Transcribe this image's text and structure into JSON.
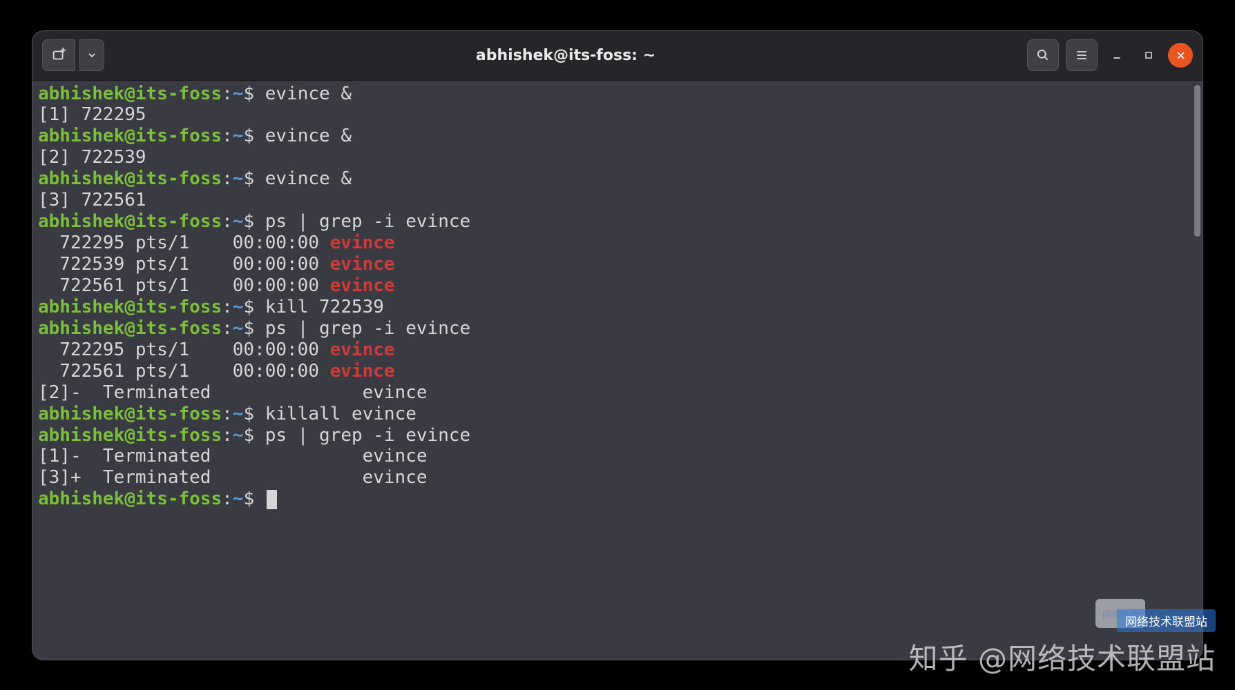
{
  "titlebar": {
    "title": "abhishek@its-foss: ~"
  },
  "prompt": {
    "user": "abhishek",
    "at": "@",
    "host": "its-foss",
    "colon": ":",
    "path": "~",
    "symbol": "$"
  },
  "lines": [
    {
      "type": "prompt",
      "cmd": "evince &"
    },
    {
      "type": "out",
      "text": "[1] 722295"
    },
    {
      "type": "prompt",
      "cmd": "evince &"
    },
    {
      "type": "out",
      "text": "[2] 722539"
    },
    {
      "type": "prompt",
      "cmd": "evince &"
    },
    {
      "type": "out",
      "text": "[3] 722561"
    },
    {
      "type": "prompt",
      "cmd": "ps | grep -i evince"
    },
    {
      "type": "ps",
      "pid": "722295",
      "tty": "pts/1",
      "time": "00:00:00",
      "name": "evince"
    },
    {
      "type": "ps",
      "pid": "722539",
      "tty": "pts/1",
      "time": "00:00:00",
      "name": "evince"
    },
    {
      "type": "ps",
      "pid": "722561",
      "tty": "pts/1",
      "time": "00:00:00",
      "name": "evince"
    },
    {
      "type": "prompt",
      "cmd": "kill 722539"
    },
    {
      "type": "prompt",
      "cmd": "ps | grep -i evince"
    },
    {
      "type": "ps",
      "pid": "722295",
      "tty": "pts/1",
      "time": "00:00:00",
      "name": "evince"
    },
    {
      "type": "ps",
      "pid": "722561",
      "tty": "pts/1",
      "time": "00:00:00",
      "name": "evince"
    },
    {
      "type": "out",
      "text": "[2]-  Terminated              evince"
    },
    {
      "type": "prompt",
      "cmd": "killall evince"
    },
    {
      "type": "prompt",
      "cmd": "ps | grep -i evince"
    },
    {
      "type": "out",
      "text": "[1]-  Terminated              evince"
    },
    {
      "type": "out",
      "text": "[3]+  Terminated              evince"
    },
    {
      "type": "prompt",
      "cmd": "",
      "cursor": true
    }
  ],
  "watermark": {
    "text": "知乎 @网络技术联盟站",
    "badge": "网络技术",
    "banner": "网络技术联盟站"
  }
}
